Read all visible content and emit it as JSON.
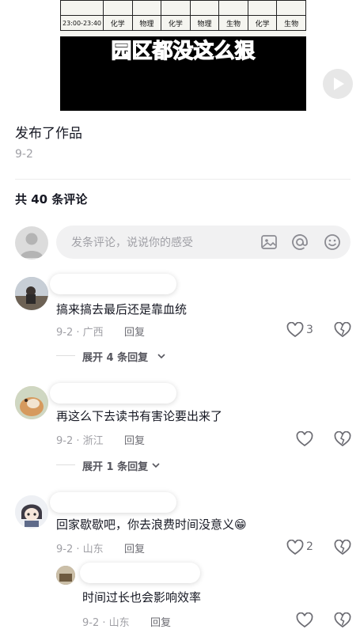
{
  "video": {
    "schedule_rows": [
      [
        "",
        "",
        "",
        "",
        "",
        "",
        "",
        "",
        ""
      ],
      [
        "23:00-23:40",
        "化学",
        "物理",
        "化学",
        "物理",
        "生物",
        "化学",
        "生物"
      ]
    ],
    "caption": "园区都没这么狠"
  },
  "post": {
    "title": "发布了作品",
    "date": "9-2"
  },
  "comments_header": "共 40 条评论",
  "composer": {
    "placeholder": "发条评论，说说你的感受"
  },
  "comments": [
    {
      "text": "搞来搞去最后还是靠血统",
      "date_region": "9-2 · 广西",
      "reply_label": "回复",
      "likes": "3",
      "expand_label": "展开 4 条回复"
    },
    {
      "text": "再这么下去读书有害论要出来了",
      "date_region": "9-2 · 浙江",
      "reply_label": "回复",
      "likes": "",
      "expand_label": "展开 1 条回复"
    },
    {
      "text": "回家歇歇吧，你去浪费时间没意义😁",
      "date_region": "9-2 · 山东",
      "reply_label": "回复",
      "likes": "2",
      "sub_reply": {
        "text": "时间过长也会影响效率",
        "date_region": "9-2 · 山东",
        "reply_label": "回复",
        "likes": ""
      }
    }
  ]
}
